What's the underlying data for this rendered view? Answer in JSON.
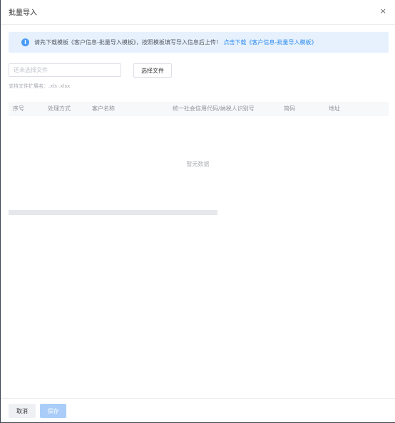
{
  "dialog": {
    "title": "批量导入",
    "close_icon": "×"
  },
  "notice": {
    "icon": "i",
    "text": "请先下载模板《客户信息-批量导入模板》，按照模板填写导入信息后上传！",
    "link": "点击下载《客户信息-批量导入模板》"
  },
  "upload": {
    "placeholder": "还未选择文件",
    "choose_label": "选择文件",
    "ext_hint": "支持文件扩展名：.xls .xlsx"
  },
  "table": {
    "columns": [
      "序号",
      "处理方式",
      "客户名称",
      "统一社会信用代码/纳税人识别号",
      "简码",
      "地址"
    ],
    "empty_text": "暂无数据"
  },
  "footer": {
    "cancel_label": "取消",
    "save_label": "保存"
  },
  "colors": {
    "accent": "#2f8bf0",
    "notice_bg": "#e6f1fd",
    "save_disabled": "#a9cdf8"
  }
}
